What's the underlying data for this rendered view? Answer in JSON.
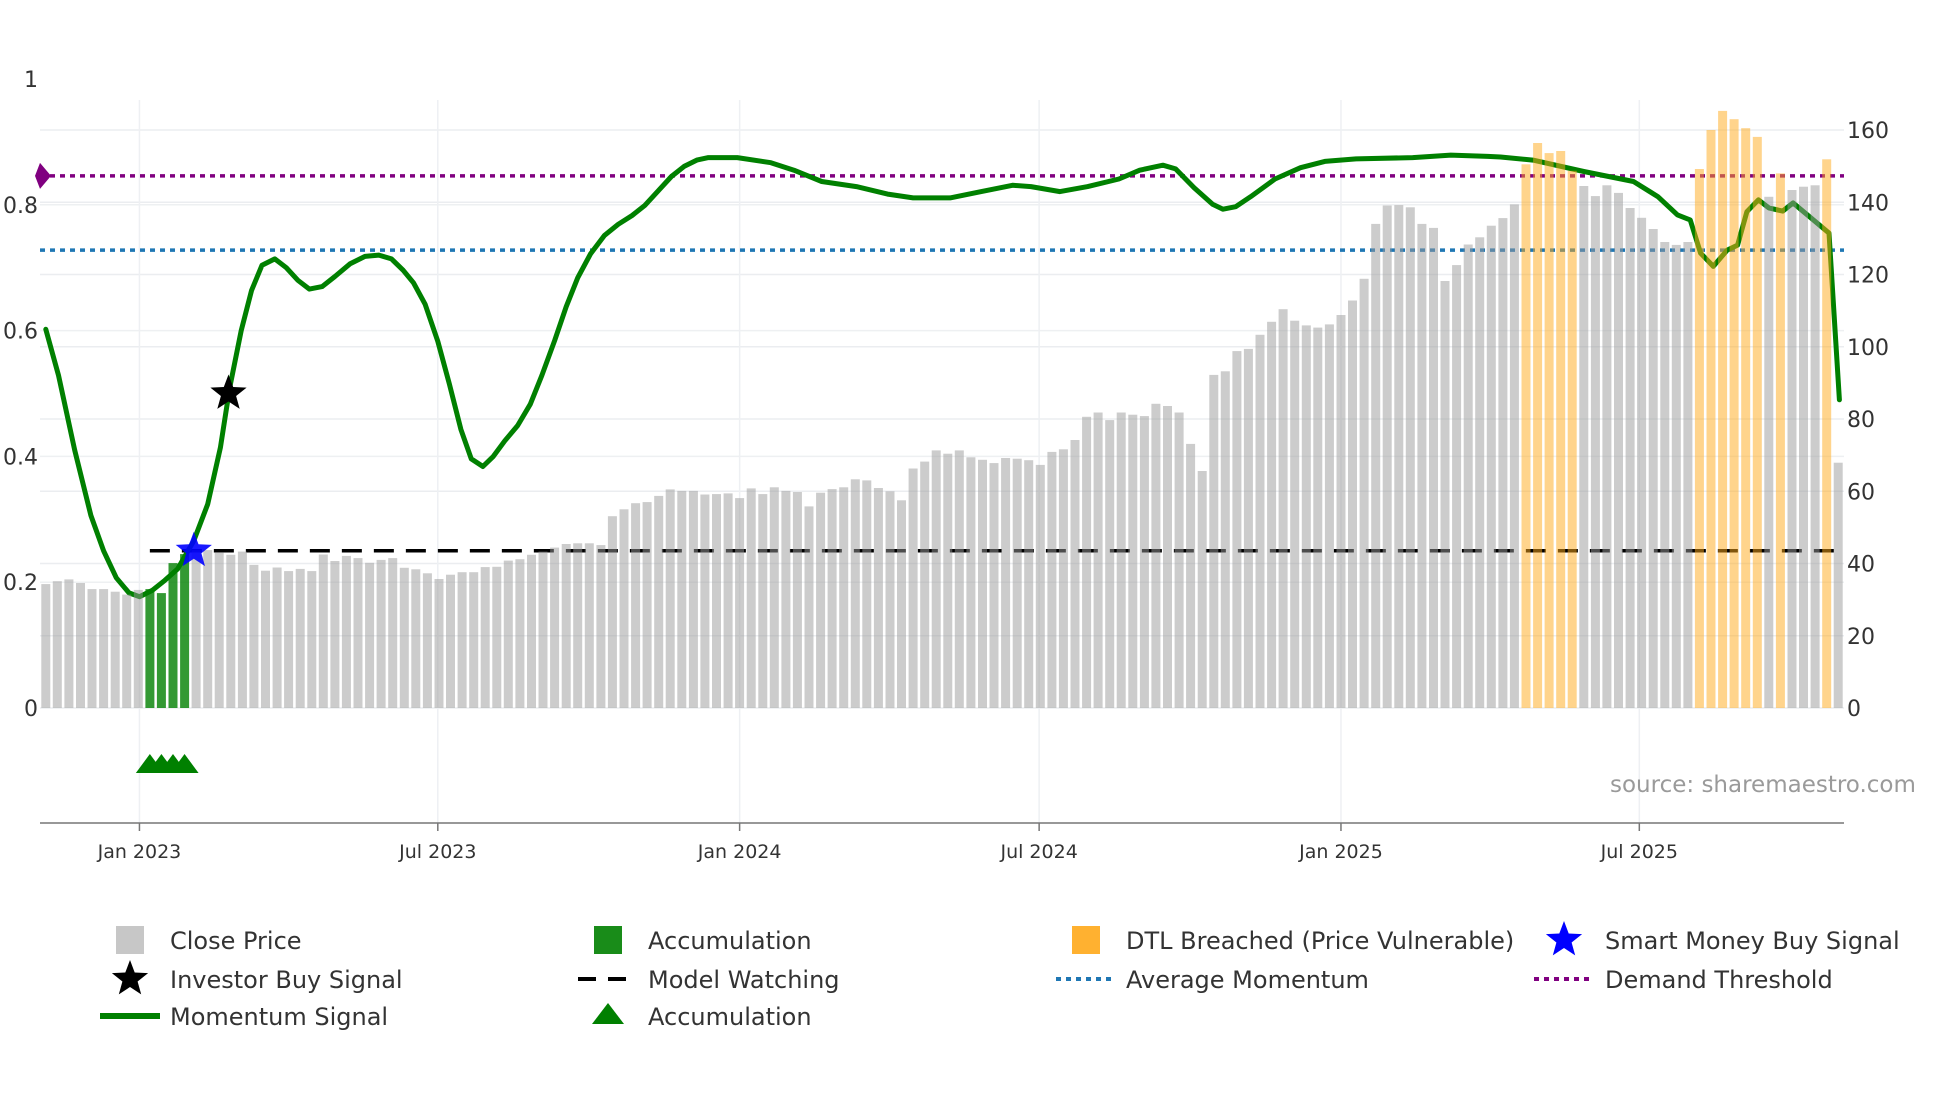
{
  "chart_data": {
    "type": "bar+line",
    "title": "",
    "source": "source: sharemaestro.com",
    "x_unit": "week index",
    "x_range": [
      -0.5,
      155.5
    ],
    "x_ticks": [
      {
        "label": "Jan 2023",
        "week": 8.1
      },
      {
        "label": "Jul 2023",
        "week": 33.9
      },
      {
        "label": "Jan 2024",
        "week": 60.0
      },
      {
        "label": "Jul 2024",
        "week": 85.9
      },
      {
        "label": "Jan 2025",
        "week": 112.0
      },
      {
        "label": "Jul 2025",
        "week": 137.8
      }
    ],
    "left_axis": {
      "range": [
        0,
        1
      ],
      "ticks": [
        0,
        0.2,
        0.4,
        0.6,
        0.8,
        1
      ],
      "tick_labels": [
        "0",
        "0.2",
        "0.4",
        "0.6",
        "0.8",
        "1"
      ]
    },
    "right_axis": {
      "range": [
        0,
        174.1
      ],
      "ticks": [
        0,
        20,
        40,
        60,
        80,
        100,
        120,
        140,
        160
      ],
      "tick_labels": [
        "0",
        "20",
        "40",
        "60",
        "80",
        "100",
        "120",
        "140",
        "160"
      ]
    },
    "close_price": [
      34.3,
      35.1,
      35.6,
      34.6,
      32.9,
      32.9,
      32.2,
      31.4,
      32.7,
      32.9,
      31.8,
      40.1,
      42.6,
      43.7,
      43.7,
      43.1,
      42.4,
      43.3,
      39.6,
      38.0,
      38.9,
      37.9,
      38.5,
      37.9,
      42.5,
      40.7,
      42.1,
      41.5,
      40.2,
      41.0,
      41.5,
      38.8,
      38.4,
      37.3,
      35.7,
      36.9,
      37.6,
      37.6,
      39.0,
      39.1,
      40.8,
      41.2,
      42.4,
      43.3,
      44.4,
      45.4,
      45.6,
      45.6,
      45.1,
      53.1,
      55.0,
      56.7,
      57.0,
      58.7,
      60.5,
      60.1,
      60.1,
      59.1,
      59.2,
      59.4,
      58.1,
      60.8,
      59.2,
      61.1,
      60.1,
      59.8,
      55.8,
      59.6,
      60.6,
      61.1,
      63.3,
      63.0,
      60.9,
      60.0,
      57.5,
      66.3,
      68.2,
      71.3,
      70.4,
      71.3,
      69.4,
      68.7,
      67.8,
      69.2,
      69.0,
      68.6,
      67.3,
      70.9,
      71.6,
      74.2,
      80.6,
      81.8,
      79.7,
      81.8,
      81.2,
      80.8,
      84.2,
      83.6,
      81.8,
      73.1,
      65.6,
      92.2,
      93.2,
      98.8,
      99.4,
      103.3,
      106.9,
      110.4,
      107.2,
      105.9,
      105.3,
      106.2,
      108.8,
      112.8,
      118.8,
      134.0,
      139.1,
      139.2,
      138.6,
      134.0,
      132.9,
      118.2,
      122.6,
      128.3,
      130.3,
      133.5,
      135.6,
      139.4,
      150.5,
      156.4,
      153.6,
      154.2,
      148.7,
      144.5,
      141.7,
      144.7,
      142.6,
      138.4,
      135.7,
      132.6,
      129.0,
      128.2,
      129.0,
      149.2,
      160.0,
      165.3,
      163.0,
      160.5,
      158.1,
      141.5,
      148.0,
      143.4,
      144.3,
      144.7,
      151.9,
      67.9
    ],
    "accumulation_weeks": [
      9,
      10,
      11,
      12
    ],
    "dtl_breached_weeks": [
      128,
      129,
      130,
      131,
      132,
      143,
      144,
      145,
      146,
      147,
      148,
      150,
      154
    ],
    "momentum_signal": [
      [
        0,
        0.602
      ],
      [
        1.1,
        0.529
      ],
      [
        2.5,
        0.41
      ],
      [
        3.9,
        0.306
      ],
      [
        5.0,
        0.25
      ],
      [
        6.1,
        0.207
      ],
      [
        7.2,
        0.183
      ],
      [
        8.1,
        0.177
      ],
      [
        9.2,
        0.187
      ],
      [
        10.3,
        0.203
      ],
      [
        11.4,
        0.221
      ],
      [
        12.8,
        0.266
      ],
      [
        14.0,
        0.324
      ],
      [
        15.1,
        0.414
      ],
      [
        15.9,
        0.509
      ],
      [
        16.9,
        0.6
      ],
      [
        17.8,
        0.664
      ],
      [
        18.7,
        0.704
      ],
      [
        19.8,
        0.714
      ],
      [
        20.8,
        0.7
      ],
      [
        21.8,
        0.68
      ],
      [
        22.8,
        0.666
      ],
      [
        23.9,
        0.67
      ],
      [
        25.0,
        0.686
      ],
      [
        26.3,
        0.706
      ],
      [
        27.6,
        0.718
      ],
      [
        28.8,
        0.72
      ],
      [
        29.9,
        0.714
      ],
      [
        30.9,
        0.696
      ],
      [
        31.8,
        0.676
      ],
      [
        32.8,
        0.642
      ],
      [
        33.9,
        0.583
      ],
      [
        34.9,
        0.515
      ],
      [
        35.9,
        0.443
      ],
      [
        36.8,
        0.396
      ],
      [
        37.8,
        0.384
      ],
      [
        38.7,
        0.4
      ],
      [
        39.7,
        0.425
      ],
      [
        40.8,
        0.449
      ],
      [
        41.9,
        0.483
      ],
      [
        42.9,
        0.529
      ],
      [
        44.0,
        0.584
      ],
      [
        45.0,
        0.638
      ],
      [
        46.0,
        0.684
      ],
      [
        47.1,
        0.722
      ],
      [
        48.3,
        0.751
      ],
      [
        49.5,
        0.769
      ],
      [
        50.7,
        0.783
      ],
      [
        51.8,
        0.799
      ],
      [
        53.0,
        0.823
      ],
      [
        54.1,
        0.845
      ],
      [
        55.2,
        0.861
      ],
      [
        56.3,
        0.871
      ],
      [
        57.3,
        0.875
      ],
      [
        59.8,
        0.875
      ],
      [
        62.7,
        0.867
      ],
      [
        64.7,
        0.855
      ],
      [
        67.1,
        0.837
      ],
      [
        70.1,
        0.829
      ],
      [
        72.8,
        0.817
      ],
      [
        75.0,
        0.811
      ],
      [
        78.2,
        0.811
      ],
      [
        80.9,
        0.821
      ],
      [
        83.6,
        0.831
      ],
      [
        85.2,
        0.829
      ],
      [
        87.7,
        0.821
      ],
      [
        90.1,
        0.829
      ],
      [
        92.8,
        0.841
      ],
      [
        94.6,
        0.855
      ],
      [
        96.6,
        0.863
      ],
      [
        97.7,
        0.857
      ],
      [
        99.3,
        0.827
      ],
      [
        100.9,
        0.801
      ],
      [
        101.8,
        0.793
      ],
      [
        102.9,
        0.797
      ],
      [
        104.2,
        0.813
      ],
      [
        106.3,
        0.841
      ],
      [
        108.5,
        0.859
      ],
      [
        110.6,
        0.869
      ],
      [
        113.3,
        0.873
      ],
      [
        118.2,
        0.875
      ],
      [
        121.5,
        0.879
      ],
      [
        124.7,
        0.877
      ],
      [
        125.8,
        0.876
      ],
      [
        128.6,
        0.871
      ],
      [
        133.0,
        0.853
      ],
      [
        137.3,
        0.837
      ],
      [
        139.4,
        0.813
      ],
      [
        141.1,
        0.784
      ],
      [
        142.2,
        0.776
      ],
      [
        143.1,
        0.723
      ],
      [
        144.2,
        0.702
      ],
      [
        145.4,
        0.728
      ],
      [
        146.3,
        0.736
      ],
      [
        147.1,
        0.789
      ],
      [
        148.1,
        0.808
      ],
      [
        149.0,
        0.795
      ],
      [
        150.2,
        0.79
      ],
      [
        151.1,
        0.803
      ],
      [
        154.2,
        0.755
      ],
      [
        155.1,
        0.49
      ]
    ],
    "model_watching": {
      "value": 0.25,
      "start_week": 9
    },
    "average_momentum": 0.728,
    "demand_threshold": 0.846,
    "investor_buy_signals": [
      {
        "week": 15.8,
        "value": 0.5
      }
    ],
    "smart_money_buy_signals": [
      {
        "week": 12.8,
        "value": 0.25
      }
    ],
    "accumulation_markers": [
      9,
      10,
      11,
      12
    ],
    "colors": {
      "close": "#999999",
      "accumulation": "#008000",
      "dtl": "#ffa91a",
      "momentum": "#008000",
      "model": "#000000",
      "average": "#1f77b4",
      "demand": "#800080",
      "smart_star": "#0000ff",
      "investor_star": "#000000"
    },
    "legend": [
      {
        "label": "Close Price",
        "icon": "gray-square"
      },
      {
        "label": "Accumulation",
        "icon": "green-square"
      },
      {
        "label": "DTL Breached (Price Vulnerable)",
        "icon": "orange-square"
      },
      {
        "label": "Smart Money Buy Signal",
        "icon": "blue-star"
      },
      {
        "label": "Investor Buy Signal",
        "icon": "black-star"
      },
      {
        "label": "Model Watching",
        "icon": "black-dashed-line"
      },
      {
        "label": "Average Momentum",
        "icon": "blue-dotted-line"
      },
      {
        "label": "Demand Threshold",
        "icon": "purple-dotted-line"
      },
      {
        "label": "Momentum Signal",
        "icon": "green-line"
      },
      {
        "label": "Accumulation",
        "icon": "green-triangle"
      }
    ]
  }
}
